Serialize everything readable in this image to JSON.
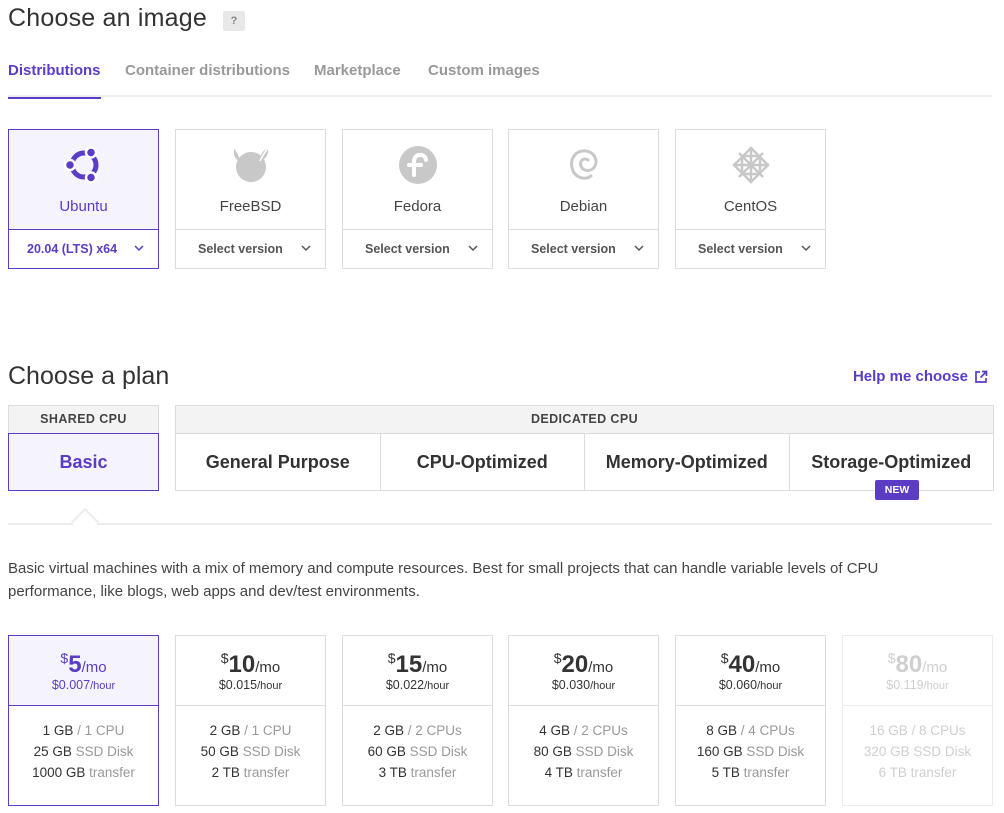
{
  "image_section": {
    "title": "Choose an image",
    "help_icon": "?",
    "tabs": [
      {
        "label": "Distributions",
        "active": true
      },
      {
        "label": "Container distributions",
        "active": false
      },
      {
        "label": "Marketplace",
        "active": false
      },
      {
        "label": "Custom images",
        "active": false
      }
    ],
    "distros": [
      {
        "name": "Ubuntu",
        "version": "20.04 (LTS) x64",
        "icon": "ubuntu-logo-icon",
        "selected": true
      },
      {
        "name": "FreeBSD",
        "version": "Select version",
        "icon": "freebsd-logo-icon",
        "selected": false
      },
      {
        "name": "Fedora",
        "version": "Select version",
        "icon": "fedora-logo-icon",
        "selected": false
      },
      {
        "name": "Debian",
        "version": "Select version",
        "icon": "debian-logo-icon",
        "selected": false
      },
      {
        "name": "CentOS",
        "version": "Select version",
        "icon": "centos-logo-icon",
        "selected": false
      }
    ]
  },
  "plan_section": {
    "title": "Choose a plan",
    "help_link": "Help me choose",
    "shared_cpu_label": "SHARED CPU",
    "basic_label": "Basic",
    "dedicated_cpu_label": "DEDICATED CPU",
    "dedicated_options": [
      "General Purpose",
      "CPU-Optimized",
      "Memory-Optimized",
      "Storage-Optimized"
    ],
    "new_badge": "NEW",
    "description": "Basic virtual machines with a mix of memory and compute resources. Best for small projects that can handle variable levels of CPU performance, like blogs, web apps and dev/test environments.",
    "plans": [
      {
        "currency": "$",
        "price": "5",
        "per": "/mo",
        "hourly": "$0.007",
        "hour_unit": "/hour",
        "mem": "1 GB",
        "cpu": "/ 1 CPU",
        "disk": "25 GB",
        "disk_label": "SSD Disk",
        "transfer": "1000 GB",
        "transfer_label": "transfer",
        "selected": true,
        "disabled": false
      },
      {
        "currency": "$",
        "price": "10",
        "per": "/mo",
        "hourly": "$0.015",
        "hour_unit": "/hour",
        "mem": "2 GB",
        "cpu": "/ 1 CPU",
        "disk": "50 GB",
        "disk_label": "SSD Disk",
        "transfer": "2 TB",
        "transfer_label": "transfer",
        "selected": false,
        "disabled": false
      },
      {
        "currency": "$",
        "price": "15",
        "per": "/mo",
        "hourly": "$0.022",
        "hour_unit": "/hour",
        "mem": "2 GB",
        "cpu": "/ 2 CPUs",
        "disk": "60 GB",
        "disk_label": "SSD Disk",
        "transfer": "3 TB",
        "transfer_label": "transfer",
        "selected": false,
        "disabled": false
      },
      {
        "currency": "$",
        "price": "20",
        "per": "/mo",
        "hourly": "$0.030",
        "hour_unit": "/hour",
        "mem": "4 GB",
        "cpu": "/ 2 CPUs",
        "disk": "80 GB",
        "disk_label": "SSD Disk",
        "transfer": "4 TB",
        "transfer_label": "transfer",
        "selected": false,
        "disabled": false
      },
      {
        "currency": "$",
        "price": "40",
        "per": "/mo",
        "hourly": "$0.060",
        "hour_unit": "/hour",
        "mem": "8 GB",
        "cpu": "/ 4 CPUs",
        "disk": "160 GB",
        "disk_label": "SSD Disk",
        "transfer": "5 TB",
        "transfer_label": "transfer",
        "selected": false,
        "disabled": false
      },
      {
        "currency": "$",
        "price": "80",
        "per": "/mo",
        "hourly": "$0.119",
        "hour_unit": "/hour",
        "mem": "16 GB",
        "cpu": "/ 8 CPUs",
        "disk": "320 GB",
        "disk_label": "SSD Disk",
        "transfer": "6 TB",
        "transfer_label": "transfer",
        "selected": false,
        "disabled": true
      }
    ]
  },
  "colors": {
    "accent": "#5b3cc4",
    "border": "#dcdcdc",
    "muted": "#999999"
  }
}
